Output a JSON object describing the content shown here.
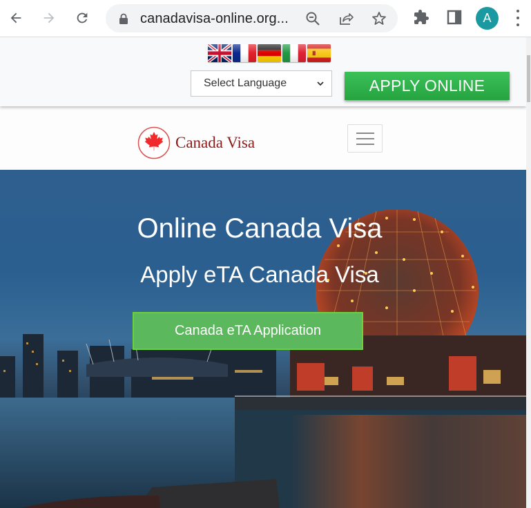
{
  "browser": {
    "url": "canadavisa-online.org...",
    "profile_initial": "A",
    "profile_color": "#1a9aa0",
    "icons": [
      "back-icon",
      "forward-icon",
      "reload-icon",
      "lock-icon",
      "zoom-out-icon",
      "share-icon",
      "bookmark-star-icon",
      "extensions-icon",
      "side-panel-icon",
      "menu-kebab-icon"
    ]
  },
  "topbar": {
    "flags": [
      {
        "name": "English",
        "code": "gb"
      },
      {
        "name": "French",
        "code": "fr"
      },
      {
        "name": "German",
        "code": "de"
      },
      {
        "name": "Italian",
        "code": "it"
      },
      {
        "name": "Spanish",
        "code": "es"
      }
    ],
    "language_select": {
      "selected": "Select Language"
    },
    "apply_button": "APPLY ONLINE",
    "apply_color": "#2db34a"
  },
  "navbar": {
    "brand": "Canada Visa",
    "brand_color": "#8b1a1a"
  },
  "hero": {
    "title": "Online Canada Visa",
    "subtitle": "Apply eTA Canada Visa",
    "cta": "Canada eTA Application",
    "cta_color": "#5cb85c"
  }
}
